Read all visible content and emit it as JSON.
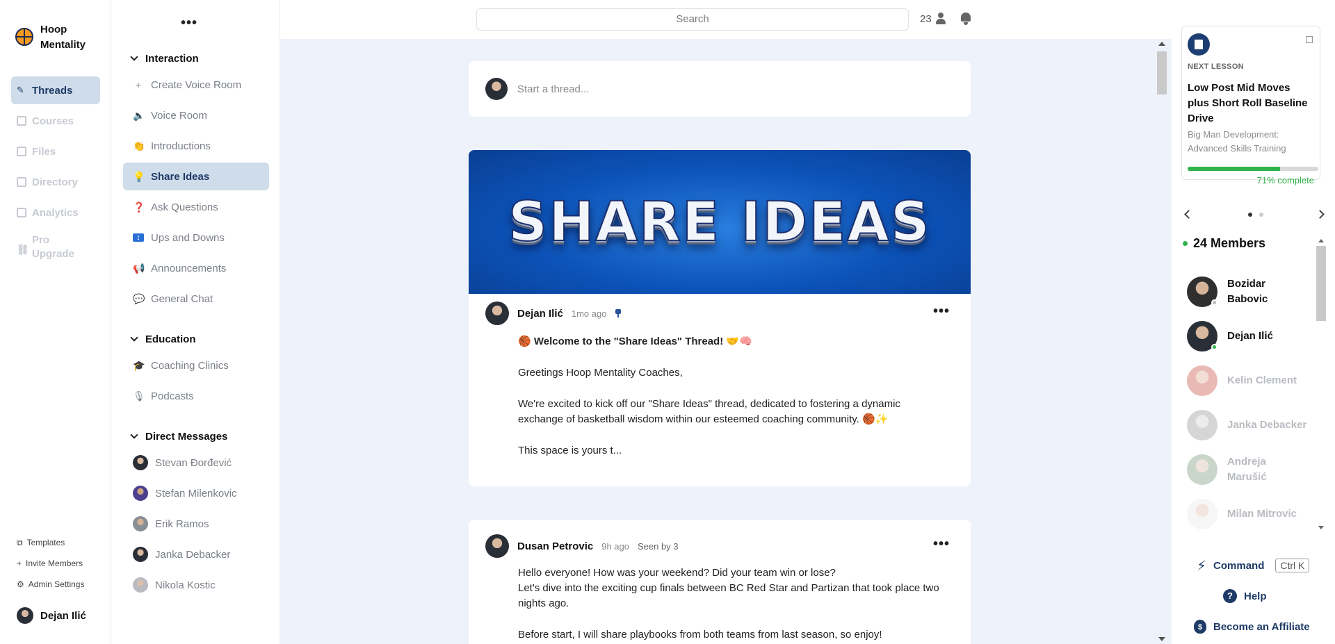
{
  "brand": {
    "name": "Hoop Mentality"
  },
  "rail": {
    "items": [
      {
        "label": "Threads",
        "icon": "feather-icon"
      },
      {
        "label": "Courses",
        "icon": "book-icon"
      },
      {
        "label": "Files",
        "icon": "file-icon"
      },
      {
        "label": "Directory",
        "icon": "directory-icon"
      },
      {
        "label": "Analytics",
        "icon": "chart-icon"
      },
      {
        "label": "Pro Upgrade",
        "icon": "link-icon"
      }
    ],
    "bottom": [
      {
        "label": "Templates",
        "icon": "templates-icon"
      },
      {
        "label": "Invite Members",
        "icon": "plus-icon"
      },
      {
        "label": "Admin Settings",
        "icon": "gear-icon"
      }
    ],
    "user": "Dejan Ilić"
  },
  "channels": {
    "sections": [
      {
        "title": "Interaction",
        "items": [
          {
            "label": "Create Voice Room",
            "emoji": "+"
          },
          {
            "label": "Voice Room",
            "emoji": "🔈"
          },
          {
            "label": "Introductions",
            "emoji": "👏"
          },
          {
            "label": "Share Ideas",
            "emoji": "💡"
          },
          {
            "label": "Ask Questions",
            "emoji": "❓"
          },
          {
            "label": "Ups and Downs",
            "emoji": "↕"
          },
          {
            "label": "Announcements",
            "emoji": "📢"
          },
          {
            "label": "General Chat",
            "emoji": "💬"
          }
        ]
      },
      {
        "title": "Education",
        "items": [
          {
            "label": "Coaching Clinics",
            "emoji": "🎓"
          },
          {
            "label": "Podcasts",
            "emoji": "🎙"
          }
        ]
      },
      {
        "title": "Direct Messages",
        "items": [
          {
            "label": "Stevan Đorđević"
          },
          {
            "label": "Stefan Milenkovic"
          },
          {
            "label": "Erik Ramos"
          },
          {
            "label": "Janka Debacker"
          },
          {
            "label": "Nikola Kostic"
          }
        ]
      }
    ]
  },
  "topbar": {
    "search_placeholder": "Search",
    "online_count": "23"
  },
  "composer": {
    "placeholder": "Start a thread..."
  },
  "posts": [
    {
      "banner": "SHARE IDEAS",
      "author": "Dejan Ilić",
      "time": "1mo ago",
      "title": "🏀 Welcome to the \"Share Ideas\" Thread! 🤝🧠",
      "paragraphs": [
        "Greetings Hoop Mentality Coaches,",
        "We're excited to kick off our \"Share Ideas\" thread, dedicated to fostering a dynamic exchange of basketball wisdom within our esteemed coaching community. 🏀✨",
        "This space is yours t..."
      ]
    },
    {
      "author": "Dusan Petrovic",
      "time": "9h ago",
      "seen": "Seen by 3",
      "paragraphs": [
        "Hello everyone! How was your weekend? Did your team win or lose?\nLet's dive into the exciting cup finals between BC Red Star and Partizan that took place two nights ago.",
        "Before start, I will share playbooks from both teams from last season, so enjoy!"
      ]
    }
  ],
  "lesson": {
    "label": "NEXT LESSON",
    "title": "Low Post Mid Moves plus Short Roll Baseline Drive",
    "course": "Big Man Development: Advanced Skills Training",
    "progress": 71,
    "progress_text": "71% complete"
  },
  "members": {
    "title": "24 Members",
    "list": [
      {
        "name": "Bozidar Babovic",
        "status": "offline",
        "dim": false
      },
      {
        "name": "Dejan Ilić",
        "status": "online",
        "dim": false
      },
      {
        "name": "Kelin Clement",
        "dim": true
      },
      {
        "name": "Janka Debacker",
        "dim": true
      },
      {
        "name": "Andreja Marušić",
        "dim": true
      },
      {
        "name": "Milan Mitrovic",
        "dim": true
      }
    ]
  },
  "links": {
    "command": "Command",
    "command_key": "Ctrl K",
    "help": "Help",
    "affiliate": "Become an Affiliate"
  },
  "colors": {
    "accent": "#1e3a66",
    "active_bg": "#cfdcea",
    "progress": "#2fb34a",
    "feed_bg": "#eef3fb"
  }
}
